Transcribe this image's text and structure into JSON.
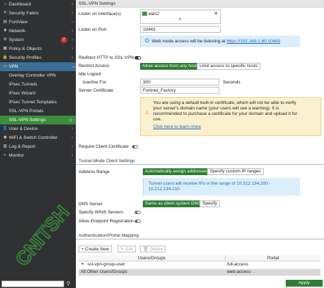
{
  "sidebar": {
    "items": [
      {
        "label": "Dashboard",
        "icon": "dashboard-icon",
        "glyph": "⌂",
        "chevron": "›"
      },
      {
        "label": "Security Fabric",
        "icon": "security-fabric-icon",
        "glyph": "✳",
        "chevron": "›"
      },
      {
        "label": "FortiView",
        "icon": "fortiview-icon",
        "glyph": "▤",
        "chevron": "›"
      },
      {
        "label": "Network",
        "icon": "network-icon",
        "glyph": "✚",
        "chevron": "›"
      },
      {
        "label": "System",
        "icon": "system-icon",
        "glyph": "⚙",
        "chevron": "›",
        "badge": "2"
      },
      {
        "label": "Policy & Objects",
        "icon": "policy-icon",
        "glyph": "▦",
        "chevron": "›"
      },
      {
        "label": "Security Profiles",
        "icon": "security-profiles-icon",
        "glyph": "🔒",
        "chevron": "›"
      },
      {
        "label": "VPN",
        "icon": "vpn-icon",
        "glyph": "▭",
        "chevron": "›"
      },
      {
        "label": "Overlay Controller VPN"
      },
      {
        "label": "IPsec Tunnels"
      },
      {
        "label": "IPsec Wizard"
      },
      {
        "label": "IPsec Tunnel Templates"
      },
      {
        "label": "SSL-VPN Portals"
      },
      {
        "label": "SSL-VPN Settings",
        "star": "☆"
      },
      {
        "label": "User & Device",
        "icon": "user-icon",
        "glyph": "👤",
        "chevron": "›"
      },
      {
        "label": "WiFi & Switch Controller",
        "icon": "wifi-icon",
        "glyph": "◉",
        "chevron": "›"
      },
      {
        "label": "Log & Report",
        "icon": "log-icon",
        "glyph": "▥",
        "chevron": "›"
      },
      {
        "label": "Monitor",
        "icon": "monitor-icon",
        "glyph": "◐",
        "chevron": "›"
      }
    ],
    "search_glyph": "⚲"
  },
  "page": {
    "title": "SSL-VPN Settings",
    "listen_interface_label": "Listen on Interface(s)",
    "interface_value": "wan2",
    "remove_glyph": "✕",
    "add_glyph": "+",
    "listen_port_label": "Listen on Port",
    "listen_port_value": "10443",
    "web_access_info": "Web mode access will be listening at",
    "web_access_link": "https://192.168.1.90:10443",
    "redirect_label": "Redirect HTTP to SSL-VPN",
    "restrict_label": "Restrict Access",
    "restrict_opt1": "Allow access from any host",
    "restrict_opt2": "Limit access to specific hosts",
    "idle_logout_label": "Idle Logout",
    "inactive_for_label": "Inactive For",
    "inactive_for_value": "300",
    "seconds_label": "Seconds",
    "server_cert_label": "Server Certificate",
    "server_cert_value": "Fortinet_Factory",
    "warn_line1": "You are using a default built-in certificate, which will not be able to verify",
    "warn_line2": "your server's domain name (your users will see a warning). It is",
    "warn_line3": "recommended to purchase a certificate for your domain and upload it for",
    "warn_line4": "use.",
    "warn_link": "Click here to learn more",
    "require_cert_label": "Require Client Certificate",
    "tunnel_section": "Tunnel Mode Client Settings",
    "address_range_label": "Address Range",
    "addr_opt1": "Automatically assign addresses",
    "addr_opt2": "Specify custom IP ranges",
    "tunnel_info1": "Tunnel users will receive IPs in the range of 10.212.134.200 -",
    "tunnel_info2": "10.212.134.210",
    "dns_label": "DNS Server",
    "dns_opt1": "Same as client system DNS",
    "dns_opt2": "Specify",
    "wins_label": "Specify WINS Servers",
    "endpoint_label": "Allow Endpoint Registration",
    "auth_section": "Authentication/Portal Mapping",
    "create_new": "+ Create New",
    "edit": "✎ Edit",
    "delete": "🗑 Delete",
    "col_users": "Users/Groups",
    "col_portal": "Portal",
    "rows": [
      {
        "users": "ssl-vpn-group-user",
        "portal": "full-access"
      },
      {
        "users": "All Other Users/Groups",
        "portal": "web-access"
      }
    ],
    "apply": "Apply"
  },
  "colors": {
    "sidebar": "#2f3133",
    "vpn_highlight": "#3c6f94",
    "active_green": "#3c8c3c",
    "button_green": "#2e7d32",
    "info_blue": "#dbeefa",
    "warning_yellow": "#fbf1cf"
  },
  "toggles": {
    "redirect": true,
    "require_cert": false,
    "wins": false,
    "endpoint": false
  }
}
